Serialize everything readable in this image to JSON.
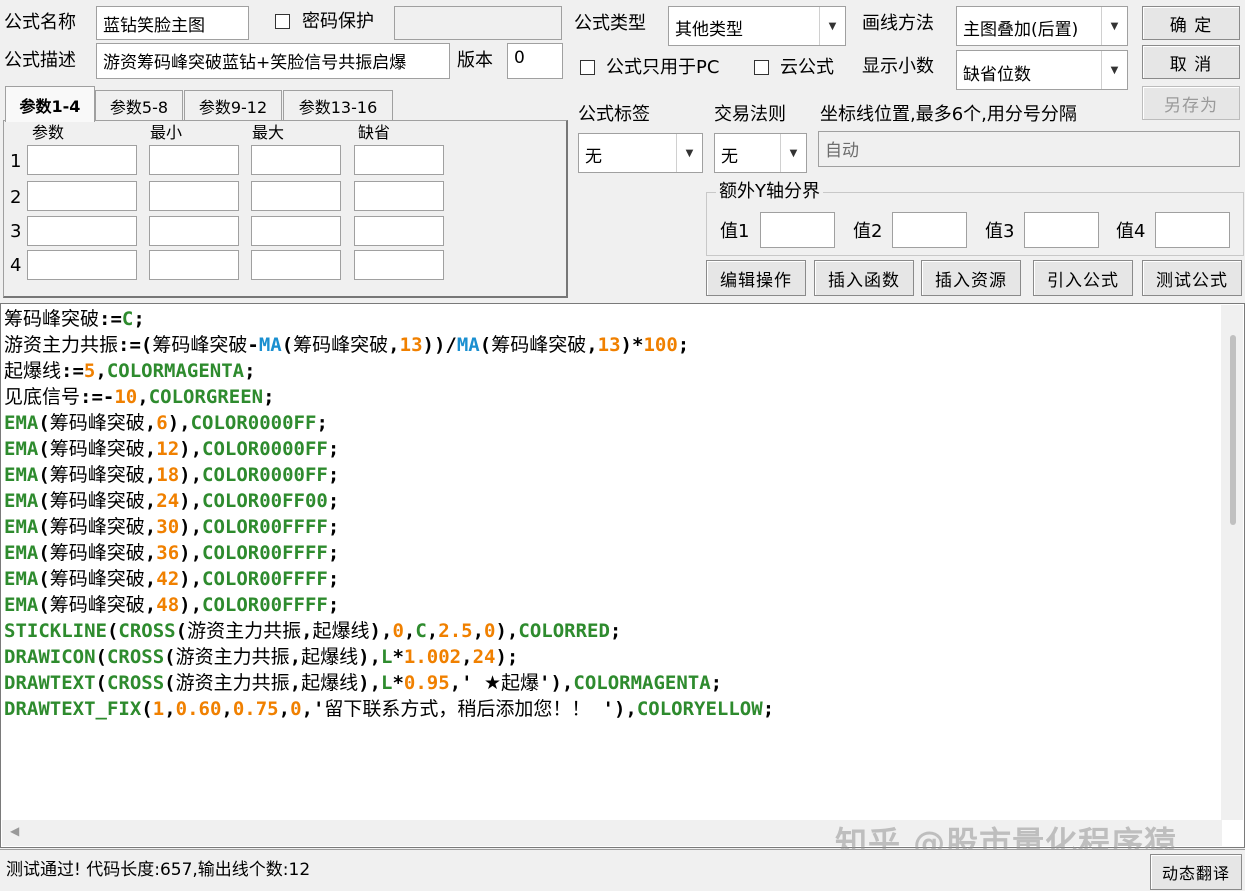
{
  "form": {
    "name_label": "公式名称",
    "name_value": "蓝钻笑脸主图",
    "password_label": "密码保护",
    "password_value": "",
    "desc_label": "公式描述",
    "desc_value": "游资筹码峰突破蓝钻+笑脸信号共振启爆",
    "version_label": "版本",
    "version_value": "0",
    "type_label": "公式类型",
    "type_value": "其他类型",
    "draw_label": "画线方法",
    "draw_value": "主图叠加(后置)",
    "pc_only_label": "公式只用于PC",
    "cloud_label": "云公式",
    "decimal_label": "显示小数",
    "decimal_value": "缺省位数",
    "tag_label": "公式标签",
    "tag_value": "无",
    "trade_label": "交易法则",
    "trade_value": "无",
    "coord_label": "坐标线位置,最多6个,用分号分隔",
    "coord_value": "自动",
    "yaxis_group_label": "额外Y轴分界",
    "yaxis_values": [
      "值1",
      "值2",
      "值3",
      "值4"
    ]
  },
  "buttons": {
    "ok": "确 定",
    "cancel": "取 消",
    "save_as": "另存为",
    "edit": "编辑操作",
    "insert_func": "插入函数",
    "insert_res": "插入资源",
    "import": "引入公式",
    "test": "测试公式",
    "translate": "动态翻译"
  },
  "params": {
    "tabs": [
      "参数1-4",
      "参数5-8",
      "参数9-12",
      "参数13-16"
    ],
    "active_tab": 0,
    "headers": [
      "参数",
      "最小",
      "最大",
      "缺省"
    ],
    "rows": [
      "1",
      "2",
      "3",
      "4"
    ]
  },
  "code_lines": [
    [
      [
        "cn",
        "筹码峰突破"
      ],
      [
        "op",
        ":="
      ],
      [
        "fn",
        "C"
      ],
      [
        "op",
        ";"
      ]
    ],
    [
      [
        "cn",
        "游资主力共振"
      ],
      [
        "op",
        ":=("
      ],
      [
        "cn",
        "筹码峰突破"
      ],
      [
        "op",
        "-"
      ],
      [
        "ma",
        "MA"
      ],
      [
        "op",
        "("
      ],
      [
        "cn",
        "筹码峰突破"
      ],
      [
        "op",
        ","
      ],
      [
        "num",
        "13"
      ],
      [
        "op",
        "))/"
      ],
      [
        "ma",
        "MA"
      ],
      [
        "op",
        "("
      ],
      [
        "cn",
        "筹码峰突破"
      ],
      [
        "op",
        ","
      ],
      [
        "num",
        "13"
      ],
      [
        "op",
        ")*"
      ],
      [
        "num",
        "100"
      ],
      [
        "op",
        ";"
      ]
    ],
    [
      [
        "cn",
        "起爆线"
      ],
      [
        "op",
        ":="
      ],
      [
        "num",
        "5"
      ],
      [
        "op",
        ","
      ],
      [
        "col",
        "COLORMAGENTA"
      ],
      [
        "op",
        ";"
      ]
    ],
    [
      [
        "cn",
        "见底信号"
      ],
      [
        "op",
        ":=-"
      ],
      [
        "num",
        "10"
      ],
      [
        "op",
        ","
      ],
      [
        "col",
        "COLORGREEN"
      ],
      [
        "op",
        ";"
      ]
    ],
    [
      [
        "fn",
        "EMA"
      ],
      [
        "op",
        "("
      ],
      [
        "cn",
        "筹码峰突破"
      ],
      [
        "op",
        ","
      ],
      [
        "num",
        "6"
      ],
      [
        "op",
        "),"
      ],
      [
        "col",
        "COLOR0000FF"
      ],
      [
        "op",
        ";"
      ]
    ],
    [
      [
        "fn",
        "EMA"
      ],
      [
        "op",
        "("
      ],
      [
        "cn",
        "筹码峰突破"
      ],
      [
        "op",
        ","
      ],
      [
        "num",
        "12"
      ],
      [
        "op",
        "),"
      ],
      [
        "col",
        "COLOR0000FF"
      ],
      [
        "op",
        ";"
      ]
    ],
    [
      [
        "fn",
        "EMA"
      ],
      [
        "op",
        "("
      ],
      [
        "cn",
        "筹码峰突破"
      ],
      [
        "op",
        ","
      ],
      [
        "num",
        "18"
      ],
      [
        "op",
        "),"
      ],
      [
        "col",
        "COLOR0000FF"
      ],
      [
        "op",
        ";"
      ]
    ],
    [
      [
        "fn",
        "EMA"
      ],
      [
        "op",
        "("
      ],
      [
        "cn",
        "筹码峰突破"
      ],
      [
        "op",
        ","
      ],
      [
        "num",
        "24"
      ],
      [
        "op",
        "),"
      ],
      [
        "col",
        "COLOR00FF00"
      ],
      [
        "op",
        ";"
      ]
    ],
    [
      [
        "fn",
        "EMA"
      ],
      [
        "op",
        "("
      ],
      [
        "cn",
        "筹码峰突破"
      ],
      [
        "op",
        ","
      ],
      [
        "num",
        "30"
      ],
      [
        "op",
        "),"
      ],
      [
        "col",
        "COLOR00FFFF"
      ],
      [
        "op",
        ";"
      ]
    ],
    [
      [
        "fn",
        "EMA"
      ],
      [
        "op",
        "("
      ],
      [
        "cn",
        "筹码峰突破"
      ],
      [
        "op",
        ","
      ],
      [
        "num",
        "36"
      ],
      [
        "op",
        "),"
      ],
      [
        "col",
        "COLOR00FFFF"
      ],
      [
        "op",
        ";"
      ]
    ],
    [
      [
        "fn",
        "EMA"
      ],
      [
        "op",
        "("
      ],
      [
        "cn",
        "筹码峰突破"
      ],
      [
        "op",
        ","
      ],
      [
        "num",
        "42"
      ],
      [
        "op",
        "),"
      ],
      [
        "col",
        "COLOR00FFFF"
      ],
      [
        "op",
        ";"
      ]
    ],
    [
      [
        "fn",
        "EMA"
      ],
      [
        "op",
        "("
      ],
      [
        "cn",
        "筹码峰突破"
      ],
      [
        "op",
        ","
      ],
      [
        "num",
        "48"
      ],
      [
        "op",
        "),"
      ],
      [
        "col",
        "COLOR00FFFF"
      ],
      [
        "op",
        ";"
      ]
    ],
    [
      [
        "fn",
        "STICKLINE"
      ],
      [
        "op",
        "("
      ],
      [
        "fn",
        "CROSS"
      ],
      [
        "op",
        "("
      ],
      [
        "cn",
        "游资主力共振"
      ],
      [
        "op",
        ","
      ],
      [
        "cn",
        "起爆线"
      ],
      [
        "op",
        "),"
      ],
      [
        "num",
        "0"
      ],
      [
        "op",
        ","
      ],
      [
        "fn",
        "C"
      ],
      [
        "op",
        ","
      ],
      [
        "num",
        "2.5"
      ],
      [
        "op",
        ","
      ],
      [
        "num",
        "0"
      ],
      [
        "op",
        "),"
      ],
      [
        "col",
        "COLORRED"
      ],
      [
        "op",
        ";"
      ]
    ],
    [
      [
        "fn",
        "DRAWICON"
      ],
      [
        "op",
        "("
      ],
      [
        "fn",
        "CROSS"
      ],
      [
        "op",
        "("
      ],
      [
        "cn",
        "游资主力共振"
      ],
      [
        "op",
        ","
      ],
      [
        "cn",
        "起爆线"
      ],
      [
        "op",
        "),"
      ],
      [
        "fn",
        "L"
      ],
      [
        "op",
        "*"
      ],
      [
        "num",
        "1.002"
      ],
      [
        "op",
        ","
      ],
      [
        "num",
        "24"
      ],
      [
        "op",
        ");"
      ]
    ],
    [
      [
        "fn",
        "DRAWTEXT"
      ],
      [
        "op",
        "("
      ],
      [
        "fn",
        "CROSS"
      ],
      [
        "op",
        "("
      ],
      [
        "cn",
        "游资主力共振"
      ],
      [
        "op",
        ","
      ],
      [
        "cn",
        "起爆线"
      ],
      [
        "op",
        "),"
      ],
      [
        "fn",
        "L"
      ],
      [
        "op",
        "*"
      ],
      [
        "num",
        "0.95"
      ],
      [
        "op",
        ",' "
      ],
      [
        "cn",
        "★起爆"
      ],
      [
        "op",
        "'),"
      ],
      [
        "col",
        "COLORMAGENTA"
      ],
      [
        "op",
        ";"
      ]
    ],
    [
      [
        "fn",
        "DRAWTEXT_FIX"
      ],
      [
        "op",
        "("
      ],
      [
        "num",
        "1"
      ],
      [
        "op",
        ","
      ],
      [
        "num",
        "0.60"
      ],
      [
        "op",
        ","
      ],
      [
        "num",
        "0.75"
      ],
      [
        "op",
        ","
      ],
      [
        "num",
        "0"
      ],
      [
        "op",
        ",'"
      ],
      [
        "cn",
        "留下联系方式，稍后添加您！！  "
      ],
      [
        "op",
        "'),"
      ],
      [
        "col",
        "COLORYELLOW"
      ],
      [
        "op",
        ";"
      ]
    ]
  ],
  "status": "测试通过! 代码长度:657,输出线个数:12",
  "watermark": "知乎 @股市量化程序猿",
  "icons": {
    "dropdown": "triangle-down",
    "scroll_left": "triangle-left"
  }
}
